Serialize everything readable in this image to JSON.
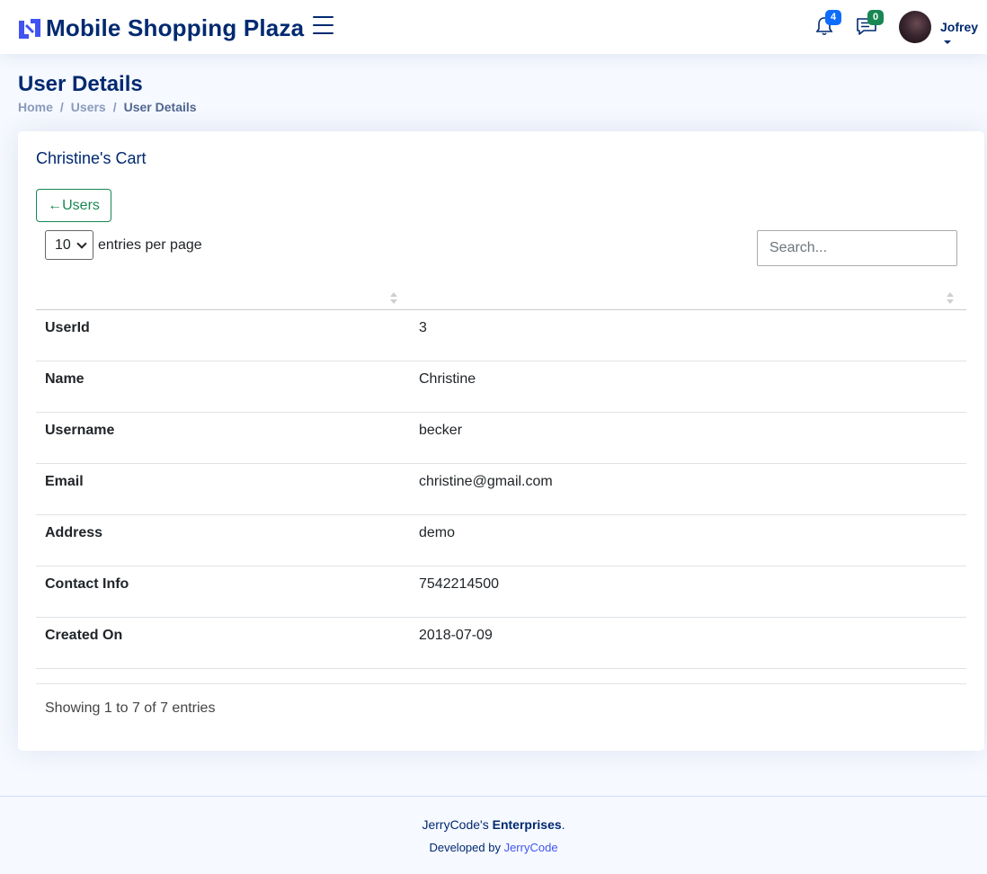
{
  "header": {
    "brand": "Mobile Shopping Plaza",
    "notifications_count": "4",
    "messages_count": "0",
    "user_name": "Jofrey",
    "colors": {
      "brand": "#012970",
      "notif_badge": "#0d6efd",
      "msg_badge": "#198754"
    }
  },
  "page": {
    "title": "User Details",
    "breadcrumb": [
      "Home",
      "Users",
      "User Details"
    ]
  },
  "card": {
    "title": "Christine's Cart",
    "back_button": "←Users",
    "per_page_value": "10",
    "per_page_label": "entries per page",
    "search_placeholder": "Search...",
    "rows": [
      {
        "key": "UserId",
        "value": "3"
      },
      {
        "key": "Name",
        "value": "Christine"
      },
      {
        "key": "Username",
        "value": "becker"
      },
      {
        "key": "Email",
        "value": "christine@gmail.com"
      },
      {
        "key": "Address",
        "value": "demo"
      },
      {
        "key": "Contact Info",
        "value": "7542214500"
      },
      {
        "key": "Created On",
        "value": "2018-07-09"
      }
    ],
    "showing": "Showing 1 to 7 of 7 entries"
  },
  "footer": {
    "copyright_prefix": "JerryCode's ",
    "copyright_strong": "Enterprises",
    "copyright_suffix": ".",
    "credits_prefix": "Developed by ",
    "credits_link": "JerryCode"
  }
}
